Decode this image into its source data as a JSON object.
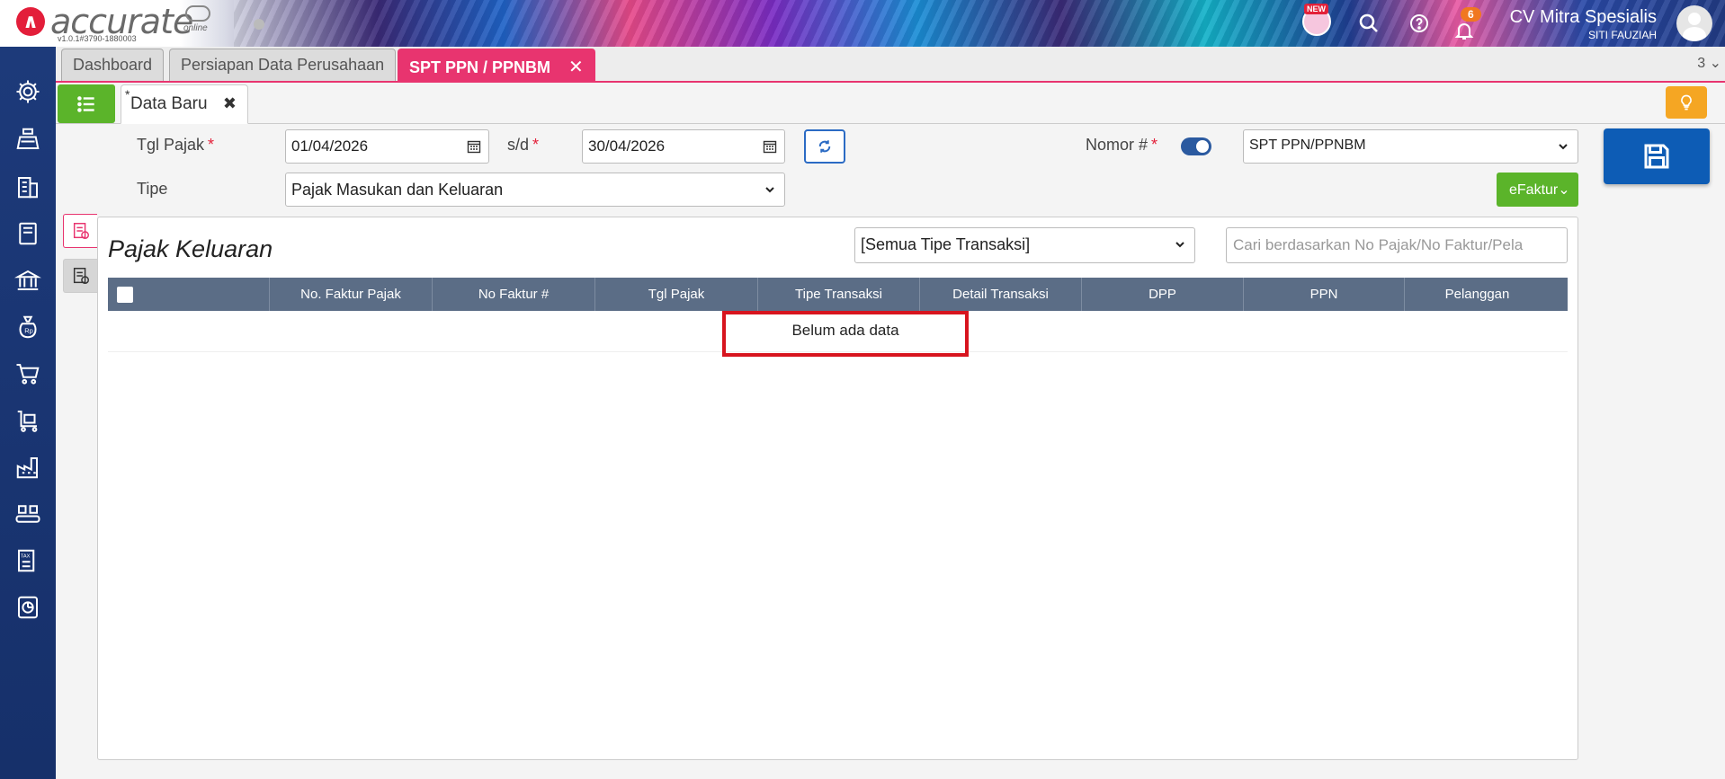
{
  "header": {
    "logo_text": "accurate",
    "logo_sub": "online",
    "version": "v1.0.1#3790-1880003",
    "new_badge": "NEW",
    "notif_count": "6",
    "company": "CV Mitra Spesialis",
    "user": "SITI FAUZIAH"
  },
  "sidebar": {
    "items": [
      "gear-icon",
      "scale-icon",
      "building-icon",
      "book-icon",
      "bank-icon",
      "money-bag-icon",
      "cart-icon",
      "trolley-icon",
      "factory-icon",
      "conveyor-icon",
      "tax-icon",
      "report-icon"
    ]
  },
  "main_tabs": [
    {
      "label": "Dashboard"
    },
    {
      "label": "Persiapan Data Perusahaan"
    },
    {
      "label": "SPT PPN / PPNBM"
    }
  ],
  "tab_count": "3",
  "sub_tab": {
    "label": "Data Baru",
    "star": "*"
  },
  "form": {
    "tgl_pajak_label": "Tgl Pajak",
    "date_from": "01/04/2026",
    "sd_label": "s/d",
    "date_to": "30/04/2026",
    "nomor_label": "Nomor #",
    "nomor_value": "SPT PPN/PPNBM",
    "tipe_label": "Tipe",
    "tipe_value": "Pajak Masukan dan Keluaran",
    "required_mark": "*",
    "efaktur_label": "eFaktur"
  },
  "panel": {
    "title": "Pajak Keluaran",
    "filter_value": "[Semua Tipe Transaksi]",
    "search_placeholder": "Cari berdasarkan No Pajak/No Faktur/Pela",
    "columns": [
      "No. Faktur Pajak",
      "No Faktur #",
      "Tgl Pajak",
      "Tipe Transaksi",
      "Detail Transaksi",
      "DPP",
      "PPN",
      "Pelanggan"
    ],
    "empty_message": "Belum ada data"
  },
  "colors": {
    "accent": "#e8346f",
    "sidebar": "#1d3a7a",
    "green": "#5bb42a",
    "save": "#0d5cb5",
    "grid_header": "#5b6d86",
    "highlight": "#d7141e"
  }
}
